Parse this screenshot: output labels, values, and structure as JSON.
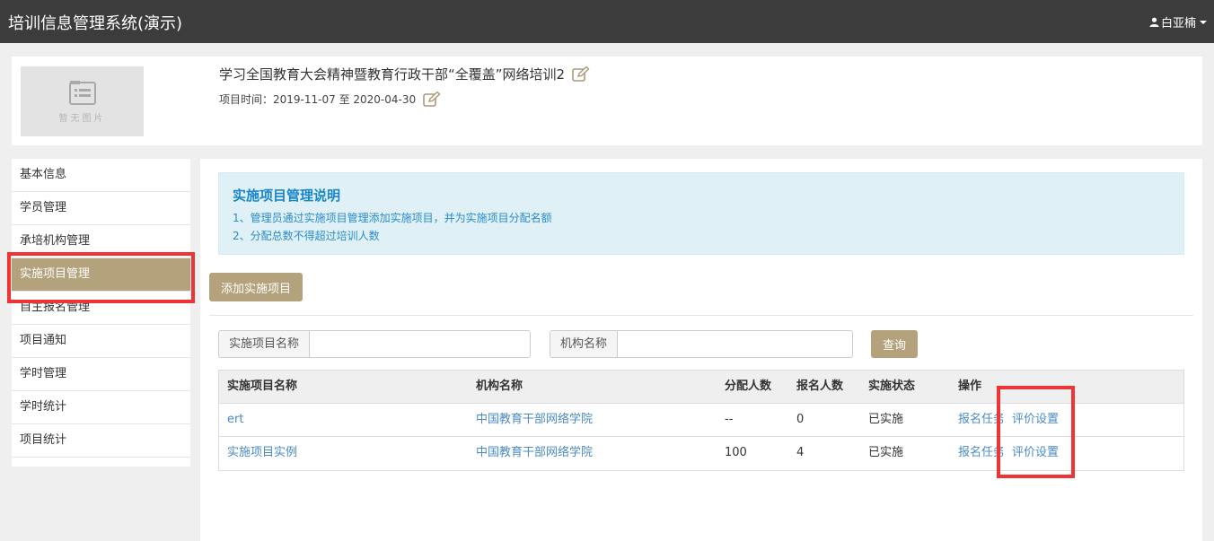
{
  "app": {
    "title": "培训信息管理系统(演示)",
    "user_name": "白亚楠"
  },
  "project": {
    "thumb_text": "暂无图片",
    "title": "学习全国教育大会精神暨教育行政干部“全覆盖”网络培训2",
    "time_label": "项目时间：",
    "time_value": "2019-11-07 至 2020-04-30"
  },
  "sidebar": {
    "items": [
      {
        "label": "基本信息"
      },
      {
        "label": "学员管理"
      },
      {
        "label": "承培机构管理"
      },
      {
        "label": "实施项目管理",
        "active": true
      },
      {
        "label": "自主报名管理"
      },
      {
        "label": "项目通知"
      },
      {
        "label": "学时管理"
      },
      {
        "label": "学时统计"
      },
      {
        "label": "项目统计"
      }
    ]
  },
  "info": {
    "title": "实施项目管理说明",
    "line1": "1、管理员通过实施项目管理添加实施项目，并为实施项目分配名额",
    "line2": "2、分配总数不得超过培训人数"
  },
  "toolbar": {
    "add_label": "添加实施项目",
    "search_label": "查询"
  },
  "filters": {
    "project_label": "实施项目名称",
    "project_value": "",
    "org_label": "机构名称",
    "org_value": ""
  },
  "table": {
    "headers": [
      "实施项目名称",
      "机构名称",
      "分配人数",
      "报名人数",
      "实施状态",
      "操作"
    ],
    "rows": [
      {
        "name": "ert",
        "org": "中国教育干部网络学院",
        "allocated": "--",
        "enrolled": "0",
        "status": "已实施",
        "op1": "报名任务",
        "op2": "评价设置"
      },
      {
        "name": "实施项目实例",
        "org": "中国教育干部网络学院",
        "allocated": "100",
        "enrolled": "4",
        "status": "已实施",
        "op1": "报名任务",
        "op2": "评价设置"
      }
    ]
  },
  "colors": {
    "topbar": "#3c3c3c",
    "accent": "#b3a27c",
    "link": "#4a8ac4",
    "info_bg": "#dff1f7",
    "highlight": "#ee3434"
  }
}
